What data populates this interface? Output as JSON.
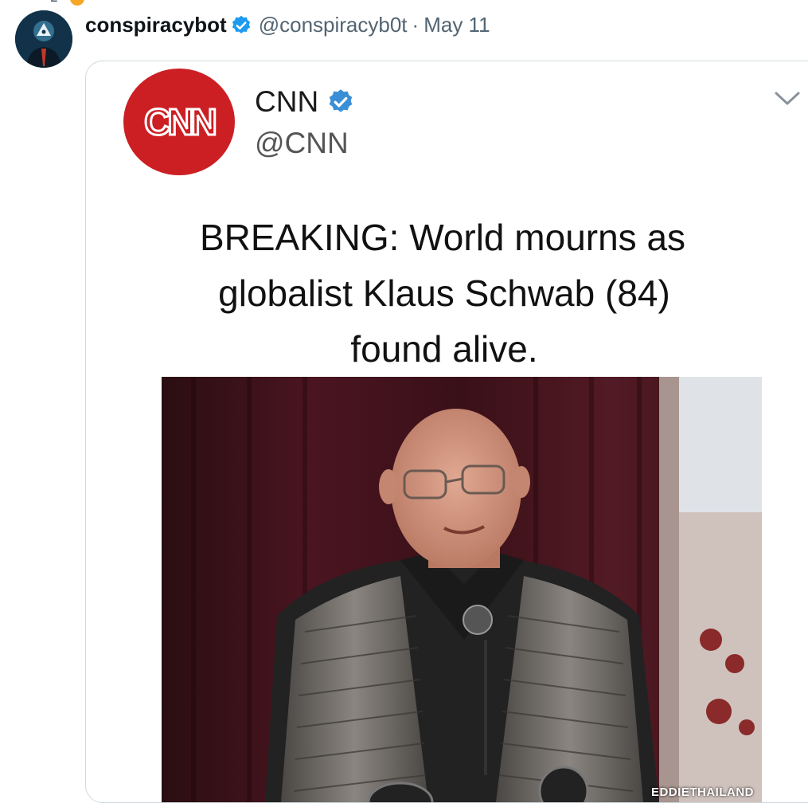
{
  "tweet": {
    "display_name": "conspiracybot",
    "handle": "@conspiracyb0t",
    "separator": "·",
    "date": "May 11",
    "avatar_icon": "illuminati-eye-avatar"
  },
  "quoted_image": {
    "account_name": "CNN",
    "account_handle": "@CNN",
    "logo_text": "CNN",
    "headline_lines": [
      "BREAKING:  World mourns as",
      "globalist Klaus Schwab (84)",
      "found alive."
    ],
    "watermark": "EDDIETHAILAND"
  },
  "colors": {
    "verified_blue": "#1d9bf0",
    "cnn_red": "#cc0000",
    "muted_text": "#536471",
    "card_border": "#cfd9de"
  }
}
